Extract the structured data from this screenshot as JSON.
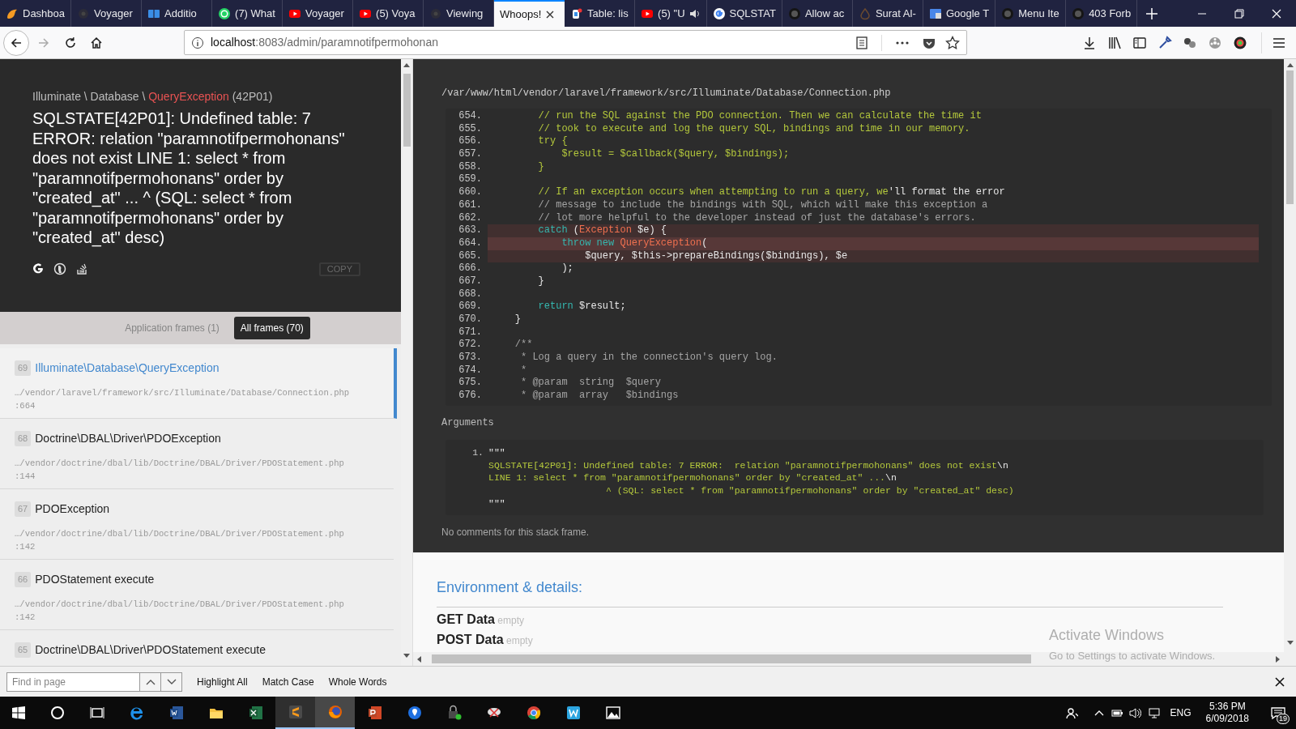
{
  "browser": {
    "tabs": [
      {
        "title": "Dashboa",
        "selected": false
      },
      {
        "title": "Voyager",
        "selected": false
      },
      {
        "title": "Additio",
        "selected": false
      },
      {
        "title": "(7) What",
        "selected": false
      },
      {
        "title": "Voyager",
        "selected": false
      },
      {
        "title": "(5) Voya",
        "selected": false
      },
      {
        "title": "Viewing",
        "selected": false
      },
      {
        "title": "Whoops!",
        "selected": true
      },
      {
        "title": "Table: lis",
        "selected": false
      },
      {
        "title": "(5) \"U",
        "selected": false
      },
      {
        "title": "SQLSTAT",
        "selected": false
      },
      {
        "title": "Allow ac",
        "selected": false
      },
      {
        "title": "Surat Al-",
        "selected": false
      },
      {
        "title": "Google T",
        "selected": false
      },
      {
        "title": "Menu Ite",
        "selected": false
      },
      {
        "title": "403 Forb",
        "selected": false
      }
    ],
    "url_host": "localhost",
    "url_rest": ":8083/admin/paramnotifpermohonan"
  },
  "exception": {
    "namespace": "Illuminate \\ Database \\ ",
    "class": "QueryException",
    "code": "(42P01)",
    "message": "SQLSTATE[42P01]: Undefined table: 7 ERROR: relation \"paramnotifpermohonans\" does not exist LINE 1: select * from \"paramnotifpermohonans\" order by \"created_at\" ... ^ (SQL: select * from \"paramnotifpermohonans\" order by \"created_at\" desc)",
    "copy_label": "COPY"
  },
  "frame_filters": [
    {
      "label": "Application frames (1)",
      "selected": false
    },
    {
      "label": "All frames (70)",
      "selected": true
    }
  ],
  "frames": [
    {
      "index": "69",
      "class": "Illuminate\\Database\\QueryException",
      "file": "…/vendor/laravel/framework/src/Illuminate/Database/Connection.php",
      "line": ":664",
      "selected": true
    },
    {
      "index": "68",
      "class": "Doctrine\\DBAL\\Driver\\PDOException",
      "file": "…/vendor/doctrine/dbal/lib/Doctrine/DBAL/Driver/PDOStatement.php",
      "line": ":144",
      "selected": false
    },
    {
      "index": "67",
      "class": "PDOException",
      "file": "…/vendor/doctrine/dbal/lib/Doctrine/DBAL/Driver/PDOStatement.php",
      "line": ":142",
      "selected": false
    },
    {
      "index": "66",
      "class": "PDOStatement execute",
      "file": "…/vendor/doctrine/dbal/lib/Doctrine/DBAL/Driver/PDOStatement.php",
      "line": ":142",
      "selected": false
    },
    {
      "index": "65",
      "class": "Doctrine\\DBAL\\Driver\\PDOStatement execute",
      "selected": false
    }
  ],
  "code": {
    "file": "/var/www/html/vendor/laravel/framework/src/Illuminate/Database/Connection.php",
    "lines": [
      {
        "no": "654.",
        "highlighted": false,
        "current": false,
        "tokens": [
          {
            "kind": "comment",
            "text": "        // run the SQL against the PDO connection. Then we can calculate the time it"
          }
        ]
      },
      {
        "no": "655.",
        "highlighted": false,
        "current": false,
        "tokens": [
          {
            "kind": "comment",
            "text": "        // took to execute and log the query SQL, bindings and time in our memory."
          }
        ]
      },
      {
        "no": "656.",
        "highlighted": false,
        "current": false,
        "tokens": [
          {
            "kind": "comment",
            "text": "        try {"
          }
        ]
      },
      {
        "no": "657.",
        "highlighted": false,
        "current": false,
        "tokens": [
          {
            "kind": "comment",
            "text": "            $result = $callback($query, $bindings);"
          }
        ]
      },
      {
        "no": "658.",
        "highlighted": false,
        "current": false,
        "tokens": [
          {
            "kind": "comment",
            "text": "        }"
          }
        ]
      },
      {
        "no": "659.",
        "highlighted": false,
        "current": false
      },
      {
        "no": "660.",
        "highlighted": false,
        "current": false,
        "tokens": [
          {
            "kind": "comment",
            "text": "        // If an exception occurs when attempting to run a query, we"
          },
          {
            "kind": "plain",
            "text": "'ll format the error"
          }
        ]
      },
      {
        "no": "661.",
        "highlighted": false,
        "current": false,
        "tokens": [
          {
            "kind": "doc",
            "text": "        // message to include the bindings with SQL, which will make this exception a"
          }
        ]
      },
      {
        "no": "662.",
        "highlighted": false,
        "current": false,
        "tokens": [
          {
            "kind": "doc",
            "text": "        // lot more helpful to the developer instead of just the database's errors."
          }
        ]
      },
      {
        "no": "663.",
        "highlighted": true,
        "current": false,
        "tokens": [
          {
            "kind": "keyword",
            "text": "        catch"
          },
          {
            "kind": "plain",
            "text": " ("
          },
          {
            "kind": "type",
            "text": "Exception"
          },
          {
            "kind": "plain",
            "text": " $e) {"
          }
        ]
      },
      {
        "no": "664.",
        "highlighted": true,
        "current": true,
        "tokens": [
          {
            "kind": "keyword",
            "text": "            throw new "
          },
          {
            "kind": "type",
            "text": "QueryException"
          },
          {
            "kind": "plain",
            "text": "("
          }
        ]
      },
      {
        "no": "665.",
        "highlighted": true,
        "current": false,
        "tokens": [
          {
            "kind": "plain",
            "text": "                $query, $this->prepareBindings($bindings), $e"
          }
        ]
      },
      {
        "no": "666.",
        "highlighted": false,
        "current": false,
        "tokens": [
          {
            "kind": "plain",
            "text": "            );"
          }
        ]
      },
      {
        "no": "667.",
        "highlighted": false,
        "current": false,
        "tokens": [
          {
            "kind": "plain",
            "text": "        }"
          }
        ]
      },
      {
        "no": "668.",
        "highlighted": false,
        "current": false
      },
      {
        "no": "669.",
        "highlighted": false,
        "current": false,
        "tokens": [
          {
            "kind": "keyword",
            "text": "        return"
          },
          {
            "kind": "plain",
            "text": " $result;"
          }
        ]
      },
      {
        "no": "670.",
        "highlighted": false,
        "current": false,
        "tokens": [
          {
            "kind": "plain",
            "text": "    }"
          }
        ]
      },
      {
        "no": "671.",
        "highlighted": false,
        "current": false
      },
      {
        "no": "672.",
        "highlighted": false,
        "current": false,
        "tokens": [
          {
            "kind": "doc",
            "text": "    /**"
          }
        ]
      },
      {
        "no": "673.",
        "highlighted": false,
        "current": false,
        "tokens": [
          {
            "kind": "doc",
            "text": "     * Log a query in the connection's query log."
          }
        ]
      },
      {
        "no": "674.",
        "highlighted": false,
        "current": false,
        "tokens": [
          {
            "kind": "doc",
            "text": "     *"
          }
        ]
      },
      {
        "no": "675.",
        "highlighted": false,
        "current": false,
        "tokens": [
          {
            "kind": "doc",
            "text": "     * @param  string  $query"
          }
        ]
      },
      {
        "no": "676.",
        "highlighted": false,
        "current": false,
        "tokens": [
          {
            "kind": "doc",
            "text": "     * @param  array   $bindings"
          }
        ]
      }
    ]
  },
  "arguments": {
    "title": "Arguments",
    "items": [
      {
        "no": "1.",
        "lines": [
          [
            {
              "kind": "plain",
              "text": "\"\"\""
            }
          ],
          [
            {
              "kind": "comment",
              "text": "SQLSTATE[42P01]: Undefined table: 7 ERROR:  relation \"paramnotifpermohonans\" does not exist"
            },
            {
              "kind": "plain",
              "text": "\\n"
            }
          ],
          [
            {
              "kind": "comment",
              "text": "LINE 1: select * from \"paramnotifpermohonans\" order by \"created_at\" ..."
            },
            {
              "kind": "plain",
              "text": "\\n"
            }
          ],
          [
            {
              "kind": "comment",
              "text": "                     ^ (SQL: select * from \"paramnotifpermohonans\" order by \"created_at\" desc)"
            }
          ],
          [
            {
              "kind": "plain",
              "text": "\"\"\""
            }
          ]
        ]
      }
    ]
  },
  "comments_note": "No comments for this stack frame.",
  "environment": {
    "title": "Environment & details:",
    "sections": [
      {
        "name": "GET Data",
        "note": "empty"
      },
      {
        "name": "POST Data",
        "note": "empty"
      }
    ]
  },
  "activation": {
    "title": "Activate Windows",
    "subtitle": "Go to Settings to activate Windows."
  },
  "find_bar": {
    "placeholder": "Find in page",
    "options": [
      "Highlight All",
      "Match Case",
      "Whole Words"
    ]
  },
  "taskbar": {
    "apps": [
      {
        "selected": false,
        "open": false
      },
      {
        "selected": false,
        "open": false
      },
      {
        "selected": false,
        "open": false
      },
      {
        "selected": false,
        "open": false
      },
      {
        "selected": false,
        "open": false
      },
      {
        "selected": false,
        "open": true
      },
      {
        "selected": true,
        "open": true
      },
      {
        "selected": false,
        "open": false
      },
      {
        "selected": false,
        "open": false
      },
      {
        "selected": false,
        "open": false
      },
      {
        "selected": false,
        "open": false
      },
      {
        "selected": false,
        "open": false
      },
      {
        "selected": false,
        "open": false
      },
      {
        "selected": false,
        "open": false
      }
    ],
    "language": "ENG",
    "time": "5:36 PM",
    "date": "6/09/2018",
    "notifications": "19"
  }
}
